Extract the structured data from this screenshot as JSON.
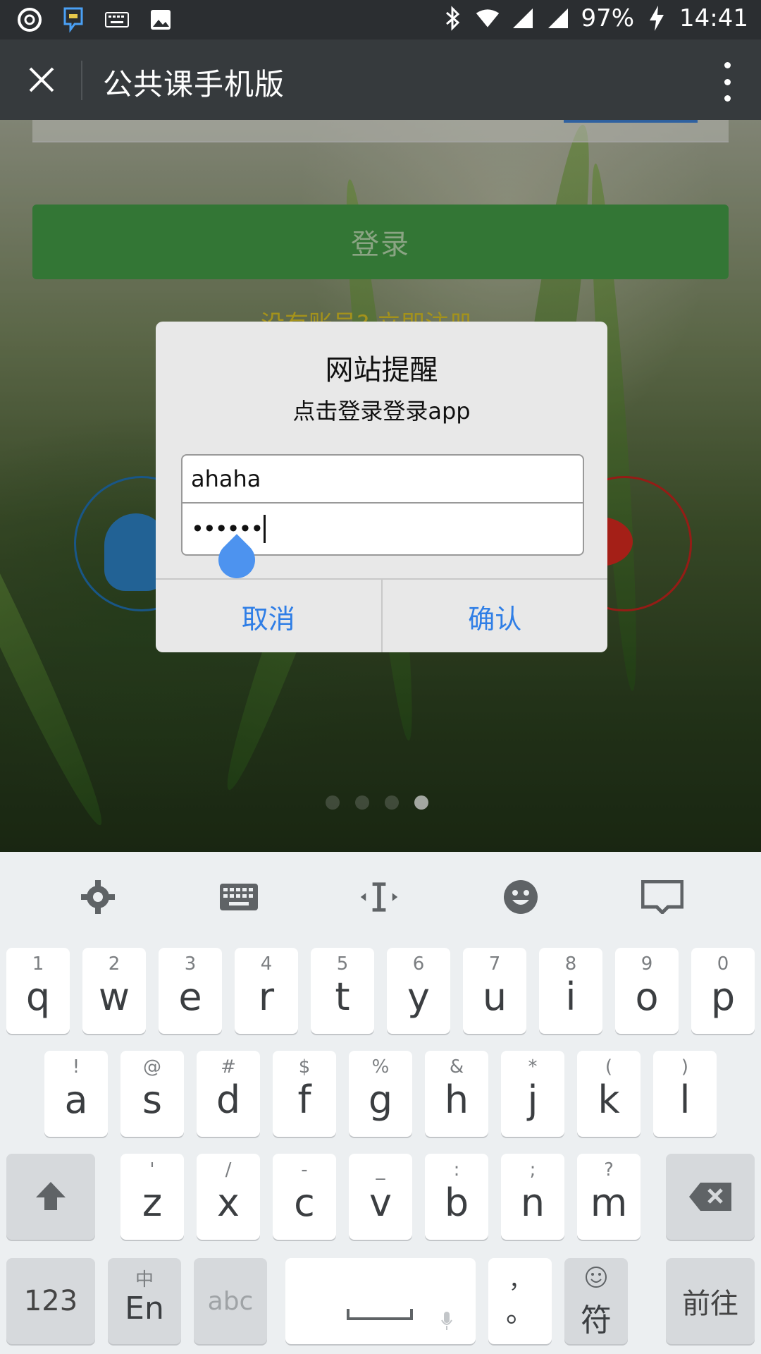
{
  "status_bar": {
    "battery": "97%",
    "time": "14:41"
  },
  "app_bar": {
    "title": "公共课手机版"
  },
  "page": {
    "login_button": "登录",
    "register_link": "没有账号? 立即注册"
  },
  "dialog": {
    "title": "网站提醒",
    "message": "点击登录登录app",
    "username_value": "ahaha",
    "password_value": "••••••",
    "cancel_label": "取消",
    "confirm_label": "确认"
  },
  "keyboard": {
    "row1": [
      {
        "sub": "1",
        "main": "q"
      },
      {
        "sub": "2",
        "main": "w"
      },
      {
        "sub": "3",
        "main": "e"
      },
      {
        "sub": "4",
        "main": "r"
      },
      {
        "sub": "5",
        "main": "t"
      },
      {
        "sub": "6",
        "main": "y"
      },
      {
        "sub": "7",
        "main": "u"
      },
      {
        "sub": "8",
        "main": "i"
      },
      {
        "sub": "9",
        "main": "o"
      },
      {
        "sub": "0",
        "main": "p"
      }
    ],
    "row2": [
      {
        "sub": "!",
        "main": "a"
      },
      {
        "sub": "@",
        "main": "s"
      },
      {
        "sub": "#",
        "main": "d"
      },
      {
        "sub": "$",
        "main": "f"
      },
      {
        "sub": "%",
        "main": "g"
      },
      {
        "sub": "&",
        "main": "h"
      },
      {
        "sub": "*",
        "main": "j"
      },
      {
        "sub": "(",
        "main": "k"
      },
      {
        "sub": ")",
        "main": "l"
      }
    ],
    "row3": [
      {
        "sub": "'",
        "main": "z"
      },
      {
        "sub": "/",
        "main": "x"
      },
      {
        "sub": "-",
        "main": "c"
      },
      {
        "sub": "_",
        "main": "v"
      },
      {
        "sub": ":",
        "main": "b"
      },
      {
        "sub": ";",
        "main": "n"
      },
      {
        "sub": "?",
        "main": "m"
      }
    ],
    "key_123": "123",
    "key_lang_sub": "中",
    "key_lang_main": "En",
    "key_abc": "abc",
    "key_punct_sub": "，",
    "key_punct_main": "。",
    "key_symbol": "符",
    "key_go": "前往"
  }
}
